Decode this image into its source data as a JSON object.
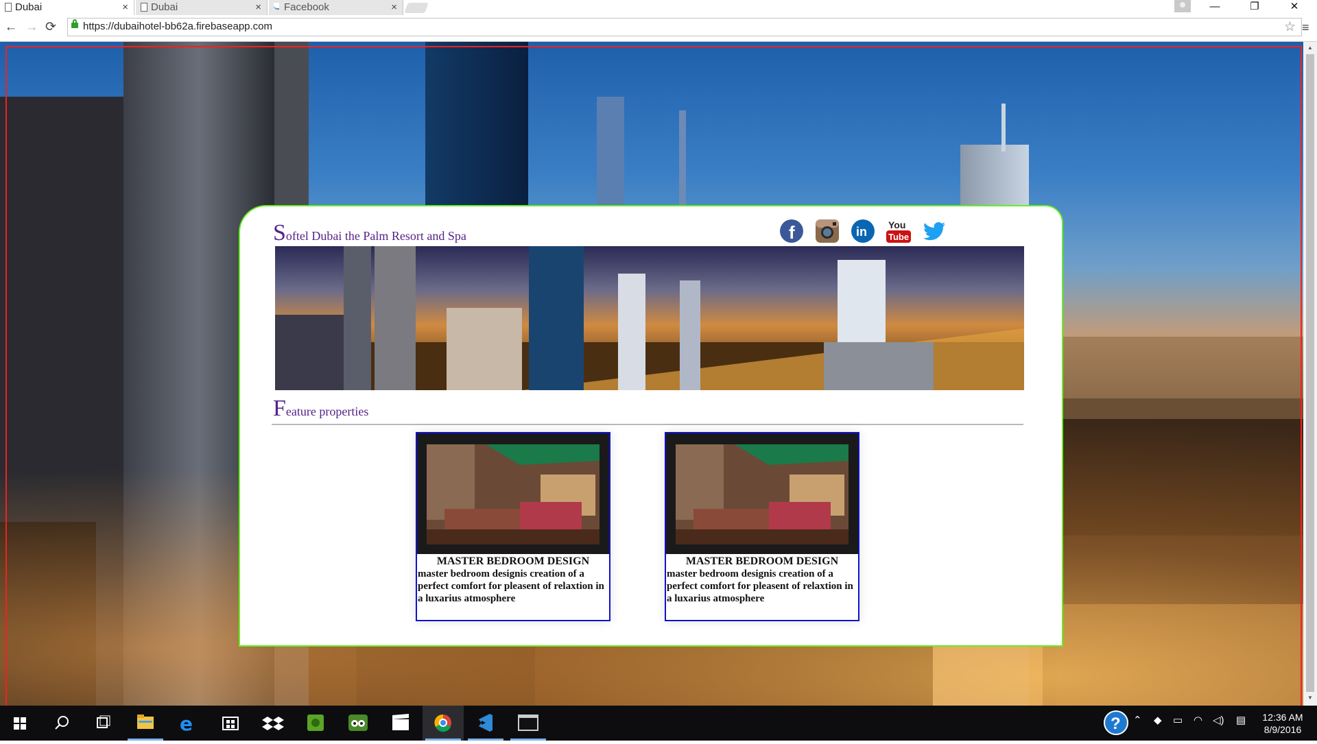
{
  "browser": {
    "tabs": [
      {
        "label": "Dubai",
        "close": "×",
        "active": true
      },
      {
        "label": "Dubai",
        "close": "×",
        "active": false
      },
      {
        "label": "Facebook",
        "close": "×",
        "active": false
      }
    ],
    "window_controls": {
      "minimize": "—",
      "restore": "❐",
      "close": "✕"
    },
    "nav": {
      "back": "←",
      "forward": "→",
      "reload": "⟳"
    },
    "url": "https://dubaihotel-bb62a.firebaseapp.com",
    "bookmark_star": "☆",
    "menu": "≡"
  },
  "page": {
    "title_initial": "S",
    "title_rest": "oftel Dubai the Palm Resort and Spa",
    "social_icons": [
      "facebook-icon",
      "instagram-icon",
      "linkedin-icon",
      "youtube-icon",
      "twitter-icon"
    ],
    "youtube_text_top": "You",
    "youtube_text_bottom": "Tube",
    "linkedin_text": "in",
    "facebook_text": "f",
    "section_initial": "F",
    "section_rest": "eature properties",
    "properties": [
      {
        "title": "MASTER BEDROOM DESIGN",
        "description": "master bedroom designis creation of a perfect comfort for pleasent of relaxtion in a luxarius atmosphere"
      },
      {
        "title": "MASTER BEDROOM DESIGN",
        "description": "master bedroom designis creation of a perfect comfort for pleasent of relaxtion in a luxarius atmosphere"
      }
    ]
  },
  "taskbar": {
    "apps": [
      "start-icon",
      "search-icon",
      "task-view-icon",
      "file-explorer-icon",
      "edge-icon",
      "store-icon",
      "dropbox-icon",
      "evernote-icon",
      "tripadvisor-icon",
      "movies-icon",
      "chrome-icon",
      "visual-studio-icon",
      "terminal-icon"
    ],
    "help": "?",
    "time": "12:36 AM",
    "date": "8/9/2016"
  },
  "colors": {
    "title_purple": "#552288",
    "card_border": "#66ee22",
    "page_border": "#ee2222",
    "property_border": "#1111cc"
  }
}
